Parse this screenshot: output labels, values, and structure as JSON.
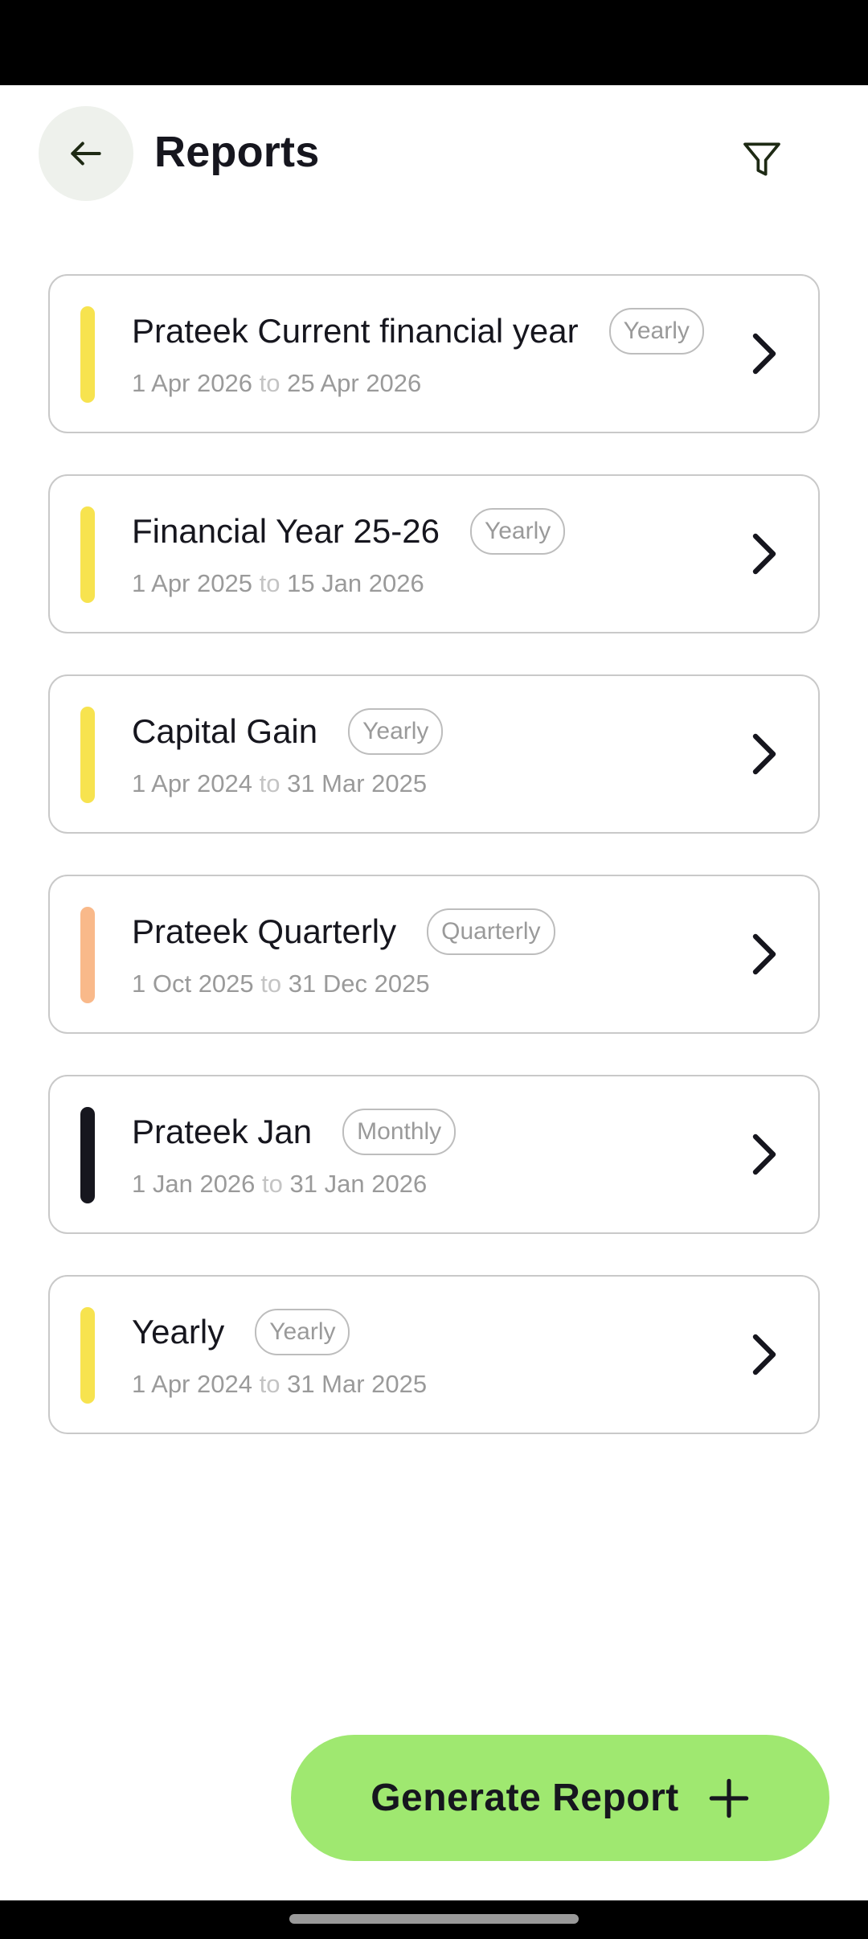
{
  "header": {
    "title": "Reports",
    "back_icon": "arrow-left-icon",
    "filter_icon": "filter-icon"
  },
  "reports": [
    {
      "name": "Prateek Current financial year",
      "period": "Yearly",
      "from": "1 Apr 2026",
      "separator": "to",
      "to": "25 Apr 2026",
      "color": "#f7e34f"
    },
    {
      "name": "Financial Year 25-26",
      "period": "Yearly",
      "from": "1 Apr 2025",
      "separator": "to",
      "to": "15 Jan 2026",
      "color": "#f7e34f"
    },
    {
      "name": "Capital Gain",
      "period": "Yearly",
      "from": "1 Apr 2024",
      "separator": "to",
      "to": "31 Mar 2025",
      "color": "#f7e34f"
    },
    {
      "name": "Prateek Quarterly",
      "period": "Quarterly",
      "from": "1 Oct 2025",
      "separator": "to",
      "to": "31 Dec 2025",
      "color": "#f9b98a"
    },
    {
      "name": "Prateek Jan",
      "period": "Monthly",
      "from": "1 Jan 2026",
      "separator": "to",
      "to": "31 Jan 2026",
      "color": "#16161e"
    },
    {
      "name": "Yearly",
      "period": "Yearly",
      "from": "1 Apr 2024",
      "separator": "to",
      "to": "31 Mar 2025",
      "color": "#f7e34f"
    }
  ],
  "generate_button": {
    "label": "Generate Report",
    "icon": "plus-icon",
    "color": "#9fe870"
  },
  "colors": {
    "text_primary": "#16161e",
    "text_secondary": "#9a9a9a",
    "card_border": "#c9c9c9",
    "back_button_bg": "#eef1ec"
  }
}
